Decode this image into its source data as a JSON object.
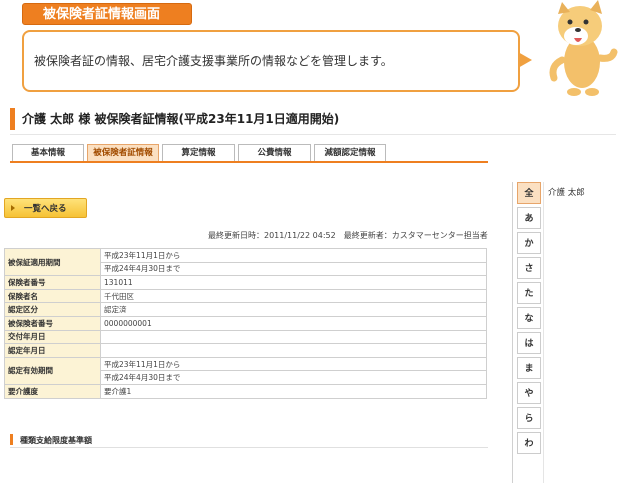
{
  "header": {
    "screen_title": "被保険者証情報画面",
    "description": "被保険者証の情報、居宅介護支援事業所の情報などを管理します。"
  },
  "page": {
    "title": "介護 太郎 様 被保険者証情報(平成23年11月1日適用開始)"
  },
  "tabs": [
    {
      "label": "基本情報"
    },
    {
      "label": "被保険者証情報"
    },
    {
      "label": "算定情報"
    },
    {
      "label": "公費情報"
    },
    {
      "label": "減額認定情報"
    }
  ],
  "back_button": {
    "label": "一覧へ戻る"
  },
  "updated_info": "最終更新日時：2011/11/22 04:52　最終更新者：カスタマーセンター担当者",
  "table": {
    "validity_label": "被保証適用期間",
    "validity_from": "平成23年11月1日から",
    "validity_to": "平成24年4月30日まで",
    "insurer_no_label": "保険者番号",
    "insurer_no": "131011",
    "insurer_name_label": "保険者名",
    "insurer_name": "千代田区",
    "cert_class_label": "認定区分",
    "cert_class": "認定済",
    "insured_no_label": "被保険者番号",
    "insured_no": "0000000001",
    "issue_date_label": "交付年月日",
    "issue_date": "",
    "cert_date_label": "認定年月日",
    "cert_date": "",
    "cert_period_label": "認定有効期間",
    "cert_from": "平成23年11月1日から",
    "cert_to": "平成24年4月30日まで",
    "care_level_label": "要介護度",
    "care_level": "要介護1"
  },
  "section": {
    "title": "種類支給限度基準額"
  },
  "sidebar": {
    "kana": [
      "全",
      "あ",
      "か",
      "さ",
      "た",
      "な",
      "は",
      "ま",
      "や",
      "ら",
      "わ"
    ],
    "person_name": "介護 太郎"
  },
  "colors": {
    "accent": "#ee7f20",
    "header_cell": "#fcf3d5",
    "active_tab": "#fbe0c2"
  }
}
